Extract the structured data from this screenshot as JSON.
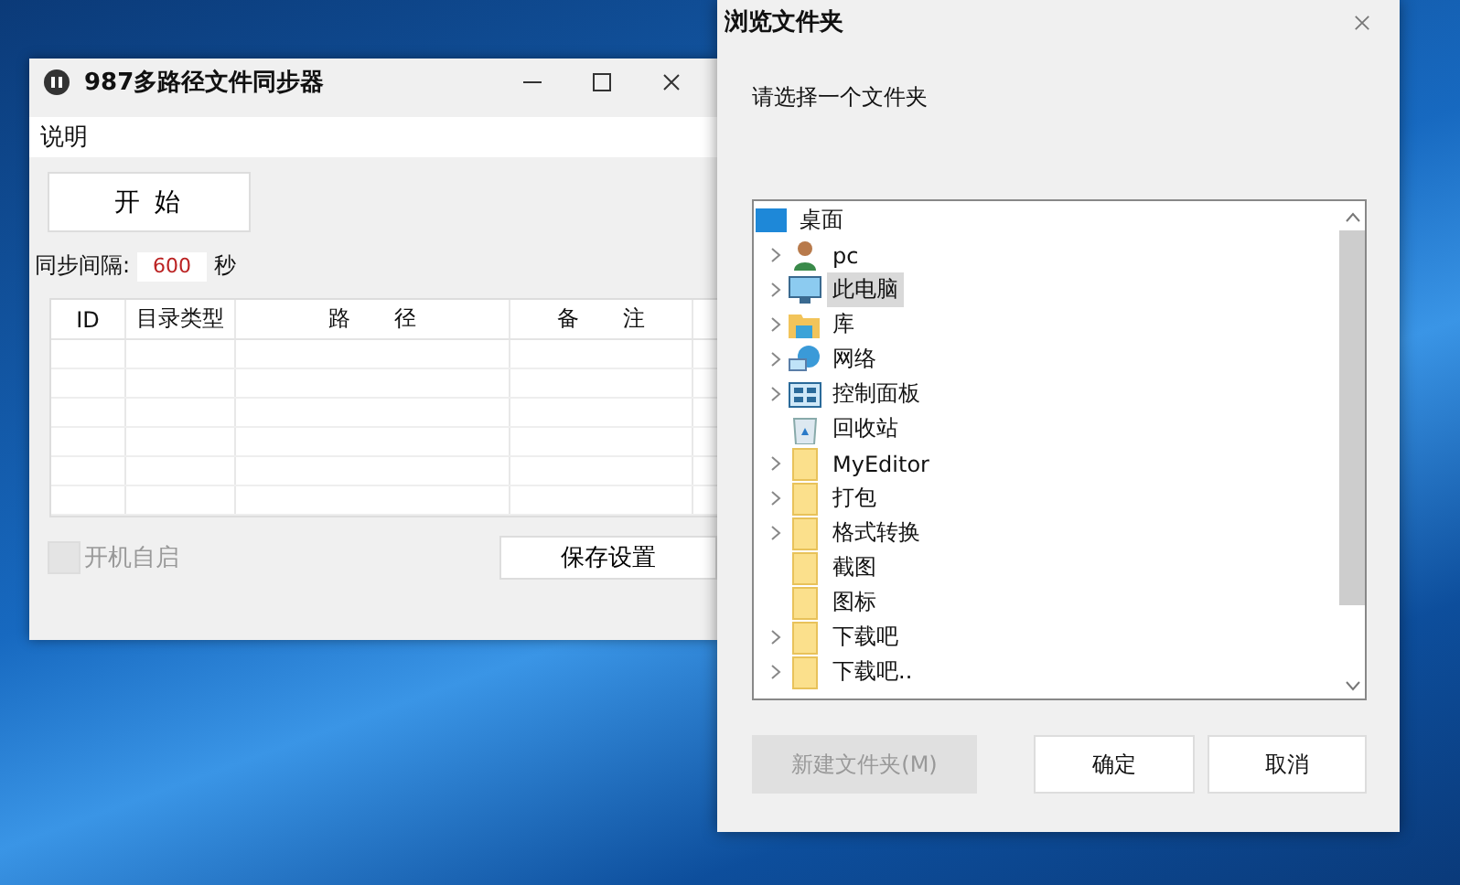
{
  "main_window": {
    "title": "987多路径文件同步器",
    "menu": [
      {
        "label": "说明"
      }
    ],
    "start_button": "开 始",
    "interval": {
      "label": "同步间隔:",
      "value": "600",
      "unit": "秒"
    },
    "table": {
      "columns": [
        "ID",
        "目录类型",
        "路　　径",
        "备　　注"
      ]
    },
    "autostart": {
      "label": "开机自启",
      "checked": false,
      "disabled": true
    },
    "save_button": "保存设置"
  },
  "dialog": {
    "title": "浏览文件夹",
    "prompt": "请选择一个文件夹",
    "tree": [
      {
        "label": "桌面",
        "kind": "desktop",
        "has_children": false,
        "selected": false,
        "children": [
          {
            "label": "pc",
            "kind": "user",
            "has_children": true,
            "selected": false
          },
          {
            "label": "此电脑",
            "kind": "computer",
            "has_children": true,
            "selected": true
          },
          {
            "label": "库",
            "kind": "library",
            "has_children": true,
            "selected": false
          },
          {
            "label": "网络",
            "kind": "network",
            "has_children": true,
            "selected": false
          },
          {
            "label": "控制面板",
            "kind": "control-panel",
            "has_children": true,
            "selected": false
          },
          {
            "label": "回收站",
            "kind": "recycle-bin",
            "has_children": false,
            "selected": false
          },
          {
            "label": "MyEditor",
            "kind": "folder",
            "has_children": true,
            "selected": false
          },
          {
            "label": "打包",
            "kind": "folder",
            "has_children": true,
            "selected": false
          },
          {
            "label": "格式转换",
            "kind": "folder",
            "has_children": true,
            "selected": false
          },
          {
            "label": "截图",
            "kind": "folder",
            "has_children": false,
            "selected": false
          },
          {
            "label": "图标",
            "kind": "folder",
            "has_children": false,
            "selected": false
          },
          {
            "label": "下载吧",
            "kind": "folder",
            "has_children": true,
            "selected": false
          },
          {
            "label": "下载吧..",
            "kind": "folder",
            "has_children": true,
            "selected": false
          }
        ]
      }
    ],
    "buttons": [
      {
        "label": "新建文件夹(M)",
        "disabled": true
      },
      {
        "label": "确定",
        "disabled": false
      },
      {
        "label": "取消",
        "disabled": false
      }
    ]
  }
}
